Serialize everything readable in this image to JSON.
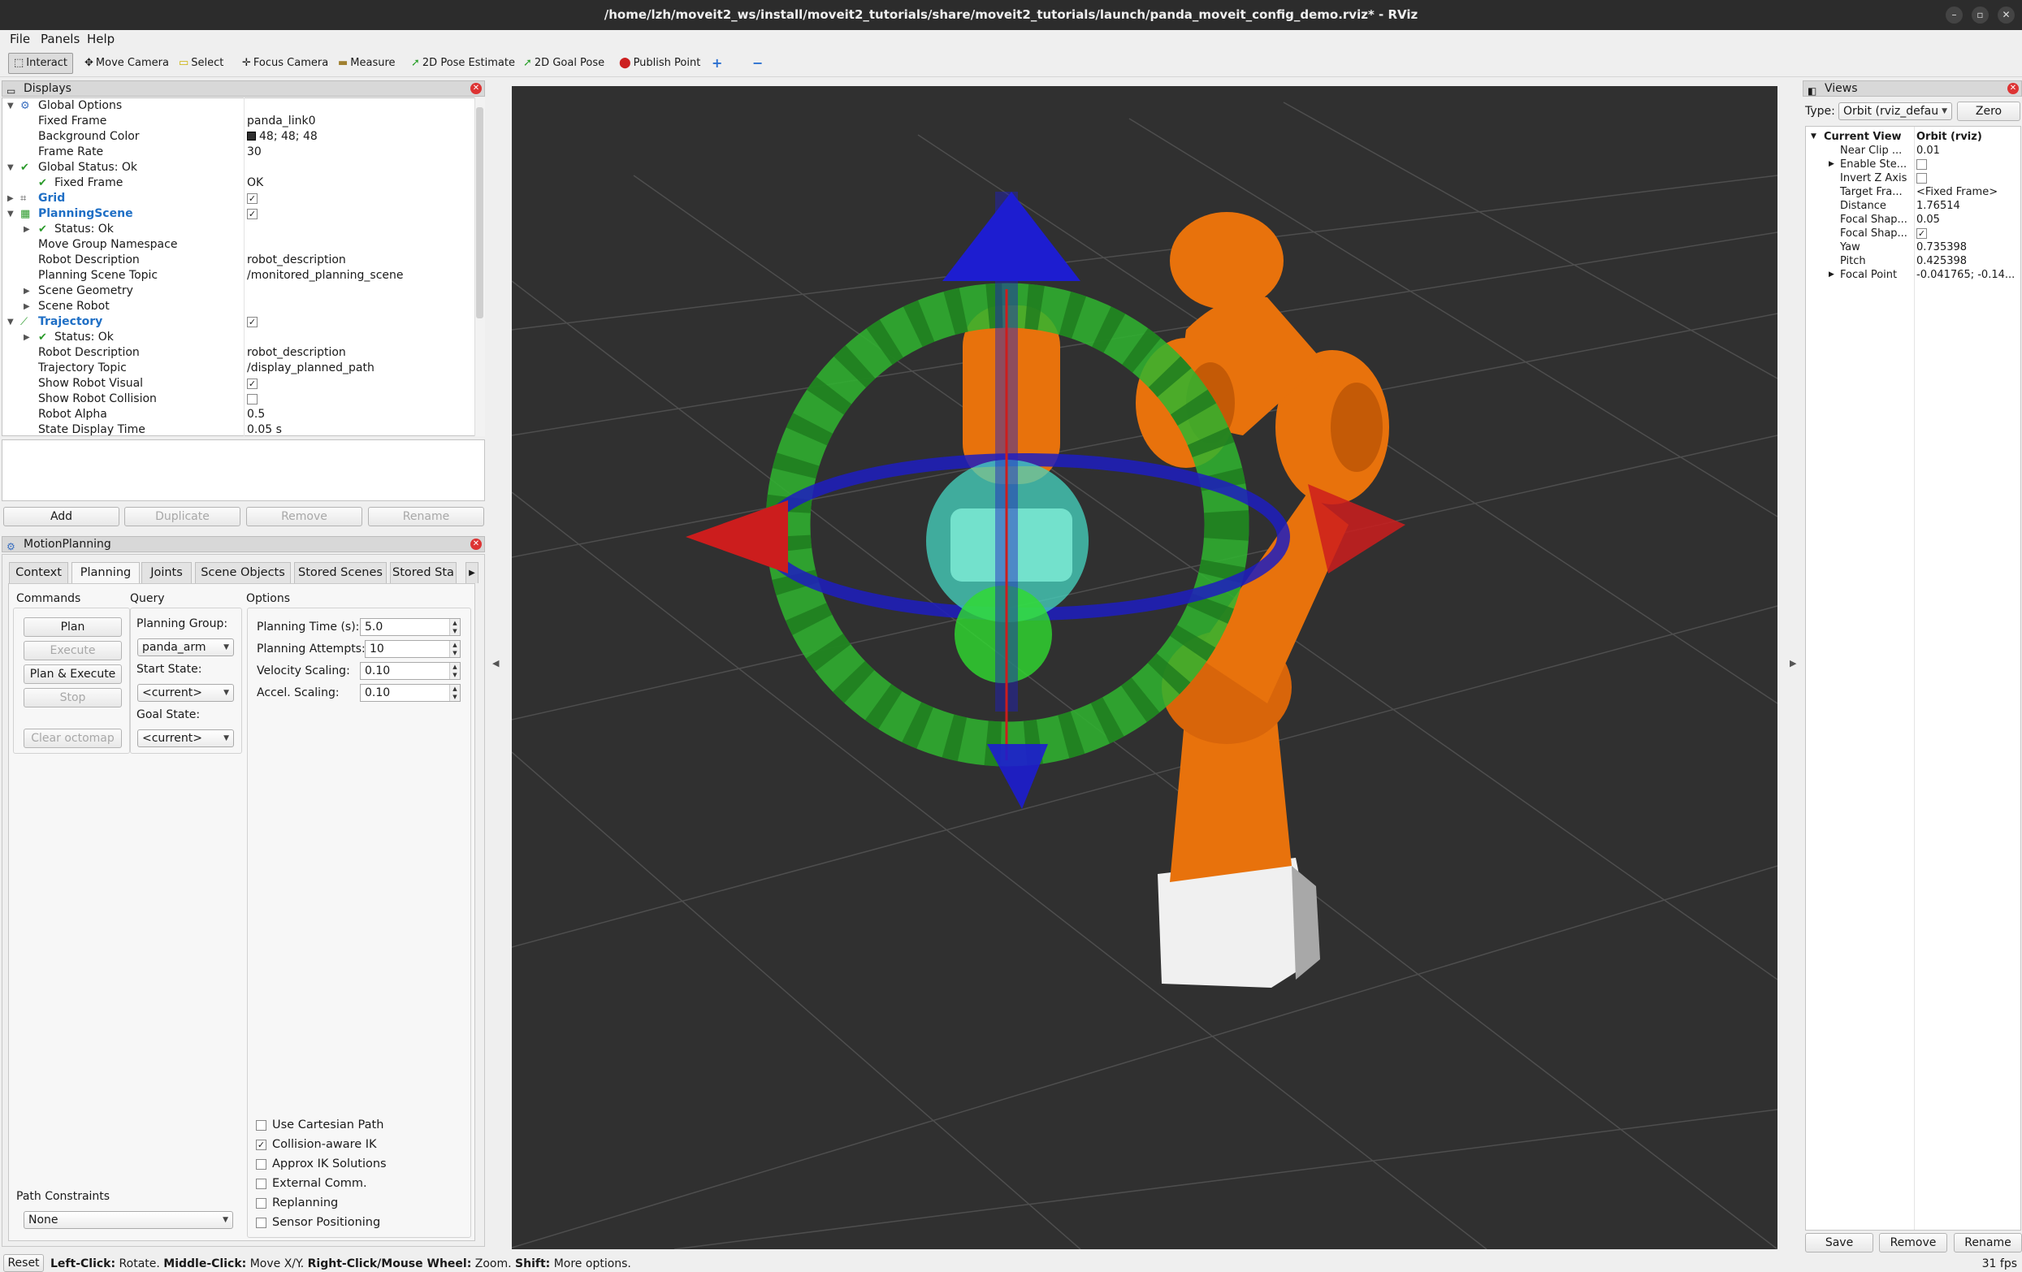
{
  "window": {
    "title": "/home/lzh/moveit2_ws/install/moveit2_tutorials/share/moveit2_tutorials/launch/panda_moveit_config_demo.rviz* - RViz",
    "controls": [
      "–",
      "▫",
      "✕"
    ]
  },
  "menu": [
    "File",
    "Panels",
    "Help"
  ],
  "toolbar": {
    "tools": [
      "Interact",
      "Move Camera",
      "Select",
      "Focus Camera",
      "Measure",
      "2D Pose Estimate",
      "2D Goal Pose",
      "Publish Point"
    ],
    "extra_icons": [
      "plus-icon",
      "minus-icon"
    ]
  },
  "displays": {
    "title": "Displays",
    "rows": [
      {
        "key": "Global Options",
        "value": ""
      },
      {
        "key": "Fixed Frame",
        "value": "panda_link0"
      },
      {
        "key": "Background Color",
        "value": "48; 48; 48"
      },
      {
        "key": "Frame Rate",
        "value": "30"
      },
      {
        "key": "Global Status: Ok",
        "value": ""
      },
      {
        "key": "Fixed Frame",
        "value": "OK"
      },
      {
        "key": "Grid",
        "value": ""
      },
      {
        "key": "PlanningScene",
        "value": ""
      },
      {
        "key": "Status: Ok",
        "value": ""
      },
      {
        "key": "Move Group Namespace",
        "value": ""
      },
      {
        "key": "Robot Description",
        "value": "robot_description"
      },
      {
        "key": "Planning Scene Topic",
        "value": "/monitored_planning_scene"
      },
      {
        "key": "Scene Geometry",
        "value": ""
      },
      {
        "key": "Scene Robot",
        "value": ""
      },
      {
        "key": "Trajectory",
        "value": ""
      },
      {
        "key": "Status: Ok",
        "value": ""
      },
      {
        "key": "Robot Description",
        "value": "robot_description"
      },
      {
        "key": "Trajectory Topic",
        "value": "/display_planned_path"
      },
      {
        "key": "Show Robot Visual",
        "value": ""
      },
      {
        "key": "Show Robot Collision",
        "value": ""
      },
      {
        "key": "Robot Alpha",
        "value": "0.5"
      },
      {
        "key": "State Display Time",
        "value": "0.05 s"
      }
    ],
    "background_color_swatch": "#303030",
    "buttons": [
      "Add",
      "Duplicate",
      "Remove",
      "Rename"
    ]
  },
  "motion_planning": {
    "title": "MotionPlanning",
    "tabs": [
      "Context",
      "Planning",
      "Joints",
      "Scene Objects",
      "Stored Scenes",
      "Stored Sta"
    ],
    "active_tab": "Planning",
    "commands": {
      "heading": "Commands",
      "plan": "Plan",
      "execute": "Execute",
      "plan_execute": "Plan & Execute",
      "stop": "Stop",
      "clear_octomap": "Clear octomap"
    },
    "query": {
      "heading": "Query",
      "planning_group_label": "Planning Group:",
      "planning_group": "panda_arm",
      "start_state_label": "Start State:",
      "start_state": "<current>",
      "goal_state_label": "Goal State:",
      "goal_state": "<current>"
    },
    "options": {
      "heading": "Options",
      "planning_time_label": "Planning Time (s):",
      "planning_time": "5.0",
      "planning_attempts_label": "Planning Attempts:",
      "planning_attempts": "10",
      "velocity_scaling_label": "Velocity Scaling:",
      "velocity_scaling": "0.10",
      "accel_scaling_label": "Accel. Scaling:",
      "accel_scaling": "0.10",
      "checkboxes": [
        {
          "label": "Use Cartesian Path",
          "checked": false
        },
        {
          "label": "Collision-aware IK",
          "checked": true
        },
        {
          "label": "Approx IK Solutions",
          "checked": false
        },
        {
          "label": "External Comm.",
          "checked": false
        },
        {
          "label": "Replanning",
          "checked": false
        },
        {
          "label": "Sensor Positioning",
          "checked": false
        }
      ]
    },
    "path_constraints": {
      "label": "Path Constraints",
      "value": "None"
    }
  },
  "views": {
    "title": "Views",
    "type_label": "Type:",
    "type_value": "Orbit (rviz_defau",
    "zero": "Zero",
    "header_key": "Current View",
    "header_value": "Orbit (rviz)",
    "rows": [
      {
        "key": "Near Clip ...",
        "value": "0.01"
      },
      {
        "key": "Enable Ste...",
        "value": ""
      },
      {
        "key": "Invert Z Axis",
        "value": ""
      },
      {
        "key": "Target Fra...",
        "value": "<Fixed Frame>"
      },
      {
        "key": "Distance",
        "value": "1.76514"
      },
      {
        "key": "Focal Shap...",
        "value": "0.05"
      },
      {
        "key": "Focal Shap...",
        "value": ""
      },
      {
        "key": "Yaw",
        "value": "0.735398"
      },
      {
        "key": "Pitch",
        "value": "0.425398"
      },
      {
        "key": "Focal Point",
        "value": "-0.041765; -0.14..."
      }
    ],
    "buttons": [
      "Save",
      "Remove",
      "Rename"
    ]
  },
  "status": {
    "reset": "Reset",
    "left_click": "Left-Click:",
    "rotate": " Rotate. ",
    "middle_click": "Middle-Click:",
    "move": " Move X/Y. ",
    "right_click": "Right-Click/Mouse Wheel:",
    "zoom": " Zoom. ",
    "shift": "Shift:",
    "more": " More options.",
    "fps": "31 fps"
  },
  "colors": {
    "viewport_bg": "#303030",
    "robot_orange": "#e8720c",
    "marker_green": "#2fb52f",
    "marker_blue": "#1d1dbf",
    "marker_red": "#cc1d1d"
  }
}
